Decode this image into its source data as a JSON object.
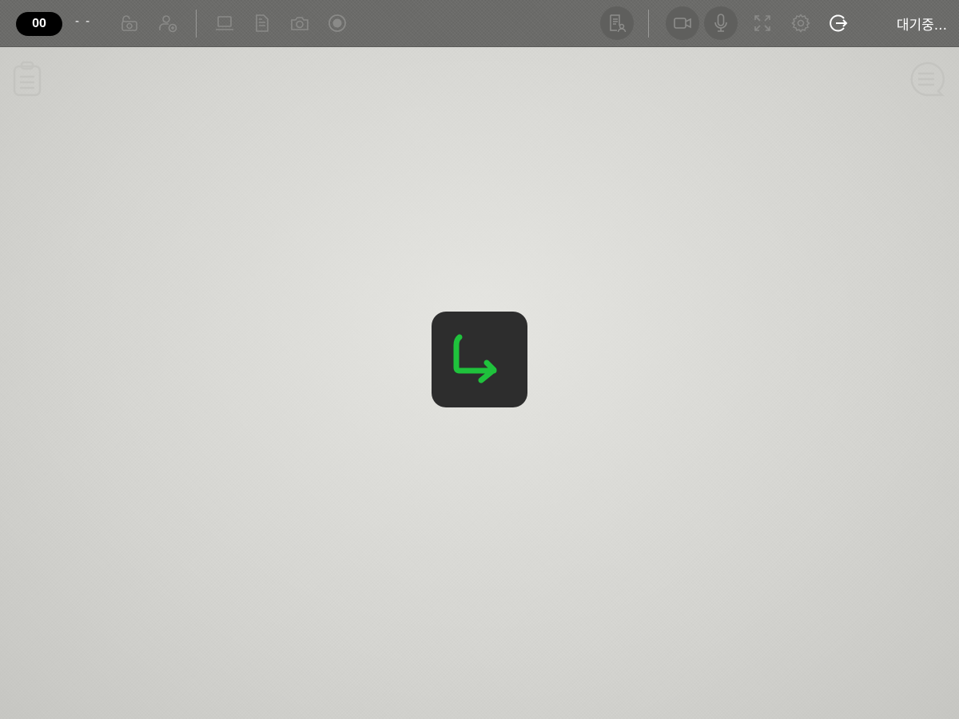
{
  "toolbar": {
    "room_number": "00",
    "room_name": "- -",
    "status": "대기중...",
    "icons": [
      "lock-camera-icon",
      "add-user-icon",
      "screen-share-icon",
      "document-icon",
      "camera-icon",
      "record-icon",
      "participants-list-icon",
      "video-icon",
      "microphone-icon",
      "fullscreen-icon",
      "settings-icon",
      "exit-icon"
    ]
  },
  "side": {
    "left_icon": "clipboard-icon",
    "right_icon": "chat-icon"
  },
  "center": {
    "icon": "return-arrow-icon",
    "accent_color": "#1fc23c"
  }
}
